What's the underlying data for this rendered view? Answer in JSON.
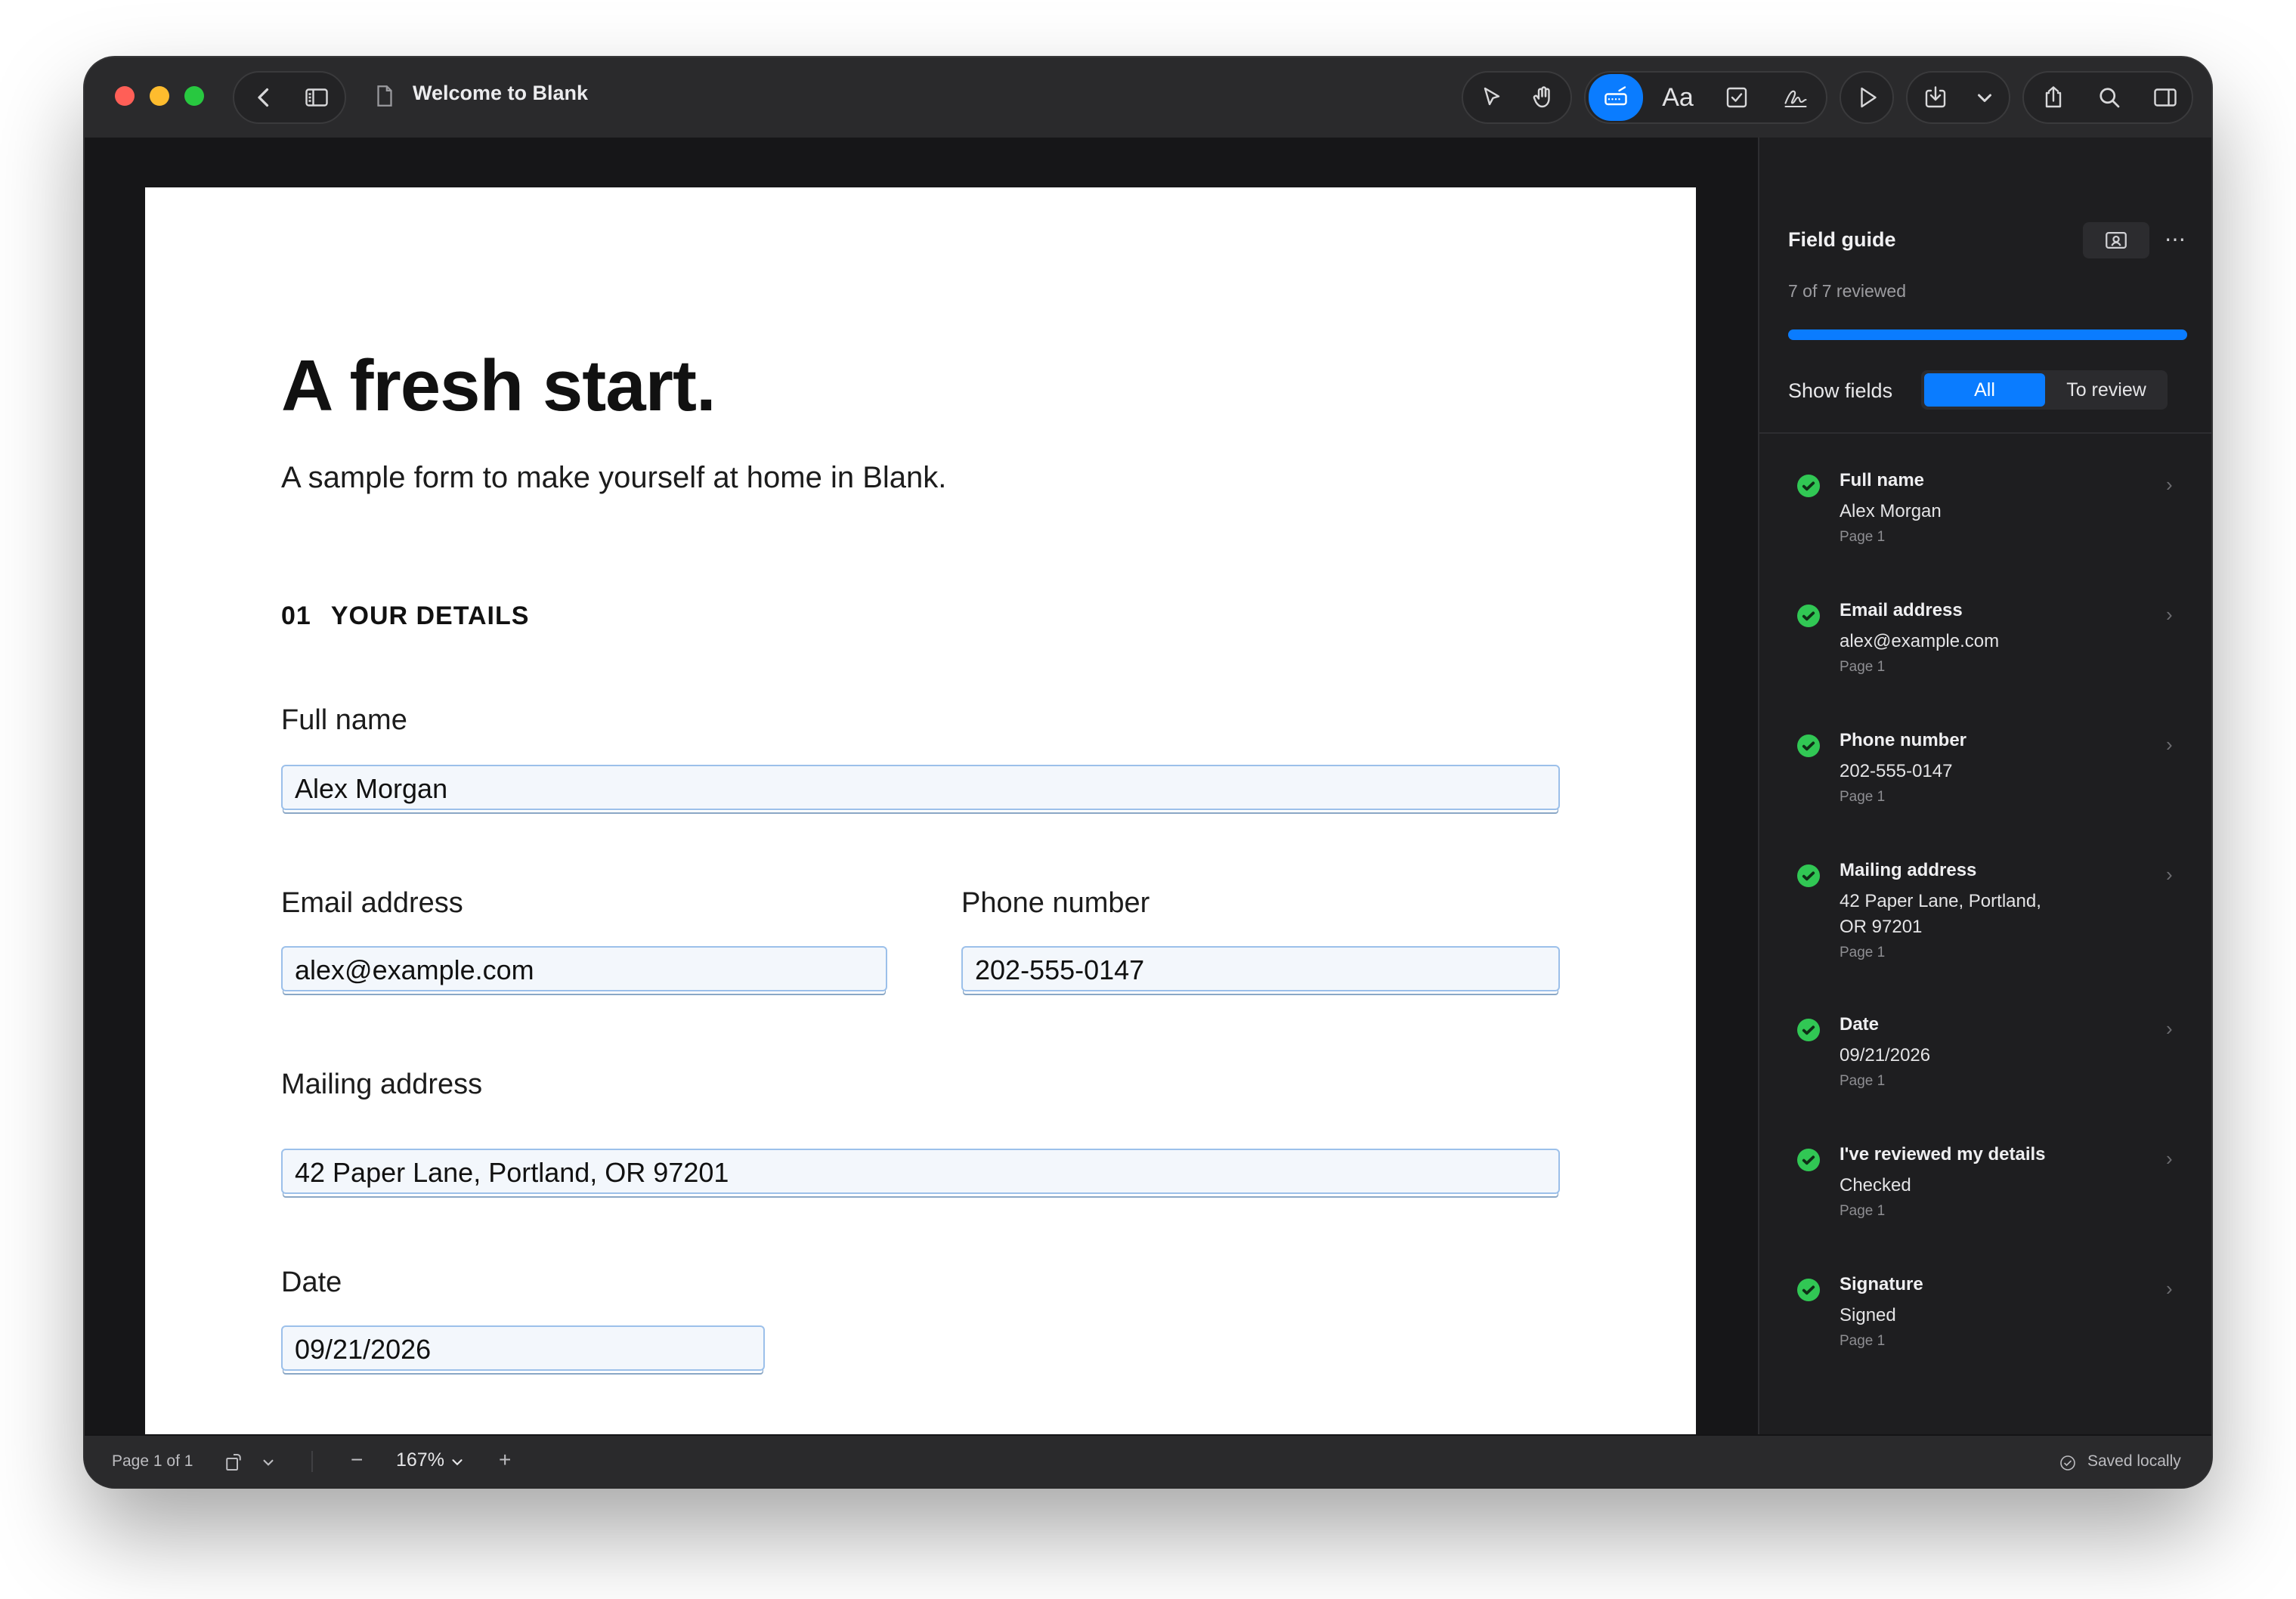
{
  "window": {
    "title": "Welcome to Blank"
  },
  "toolbar": {
    "text_tool_label": "Aa",
    "icons": [
      "chevron-left-icon",
      "sidebar-icon",
      "document-icon",
      "pointer-icon",
      "hand-icon",
      "form-fill-icon",
      "checkbox-icon",
      "signature-icon",
      "play-icon",
      "download-icon",
      "chevron-down-icon",
      "share-icon",
      "search-icon",
      "inspector-icon"
    ],
    "accent": "#0a7cff"
  },
  "document": {
    "heading": "A fresh start.",
    "subheading": "A sample form to make yourself at home in Blank.",
    "section_number": "01",
    "section_title": "YOUR DETAILS",
    "fields": {
      "full_name": {
        "label": "Full name",
        "value": "Alex Morgan"
      },
      "email": {
        "label": "Email address",
        "value": "alex@example.com"
      },
      "phone": {
        "label": "Phone number",
        "value": "202-555-0147"
      },
      "address": {
        "label": "Mailing address",
        "value": "42 Paper Lane, Portland, OR 97201"
      },
      "date": {
        "label": "Date",
        "value": "09/21/2026"
      }
    }
  },
  "panel": {
    "title": "Field guide",
    "reviewed_text": "7 of 7 reviewed",
    "progress_fraction": 1.0,
    "show_fields_label": "Show fields",
    "filter_all": "All",
    "filter_review": "To review",
    "more_label": "⋯",
    "items": [
      {
        "label": "Full name",
        "value": "Alex Morgan",
        "page": "Page 1"
      },
      {
        "label": "Email address",
        "value": "alex@example.com",
        "page": "Page 1"
      },
      {
        "label": "Phone number",
        "value": "202-555-0147",
        "page": "Page 1"
      },
      {
        "label": "Mailing address",
        "value": "42 Paper Lane, Portland, OR 97201",
        "page": "Page 1"
      },
      {
        "label": "Date",
        "value": "09/21/2026",
        "page": "Page 1"
      },
      {
        "label": "I've reviewed my details",
        "value": "Checked",
        "page": "Page 1"
      },
      {
        "label": "Signature",
        "value": "Signed",
        "page": "Page 1"
      }
    ],
    "status_color": "#31c754"
  },
  "statusbar": {
    "page_info": "Page 1 of 1",
    "zoom": "167%",
    "zoom_out": "−",
    "zoom_in": "+",
    "save_status": "Saved locally"
  }
}
